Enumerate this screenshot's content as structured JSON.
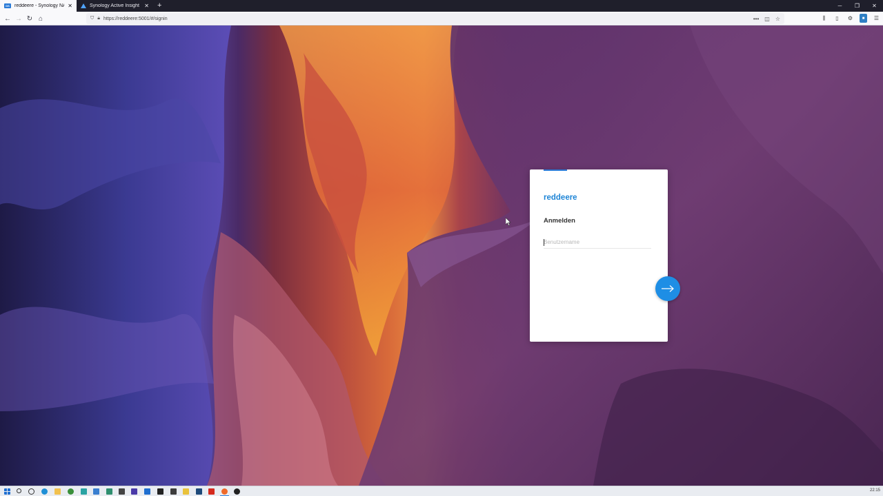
{
  "browser": {
    "tabs": [
      {
        "title": "reddeere - Synology NAS",
        "active": true
      },
      {
        "title": "Synology Active Insight",
        "active": false
      }
    ],
    "url": "https://reddeere:5001/#/signin",
    "new_tab_symbol": "+",
    "window_controls": [
      "minimize-icon",
      "restore-icon",
      "close-icon"
    ]
  },
  "login": {
    "server_name": "reddeere",
    "title": "Anmelden",
    "username_placeholder": "Benutzername",
    "username_value": "",
    "next_icon": "arrow-right-icon"
  },
  "colors": {
    "accent": "#1d84d6",
    "button": "#1e8ee5",
    "card": "#ffffff"
  },
  "taskbar": {
    "clock": "22:15"
  }
}
